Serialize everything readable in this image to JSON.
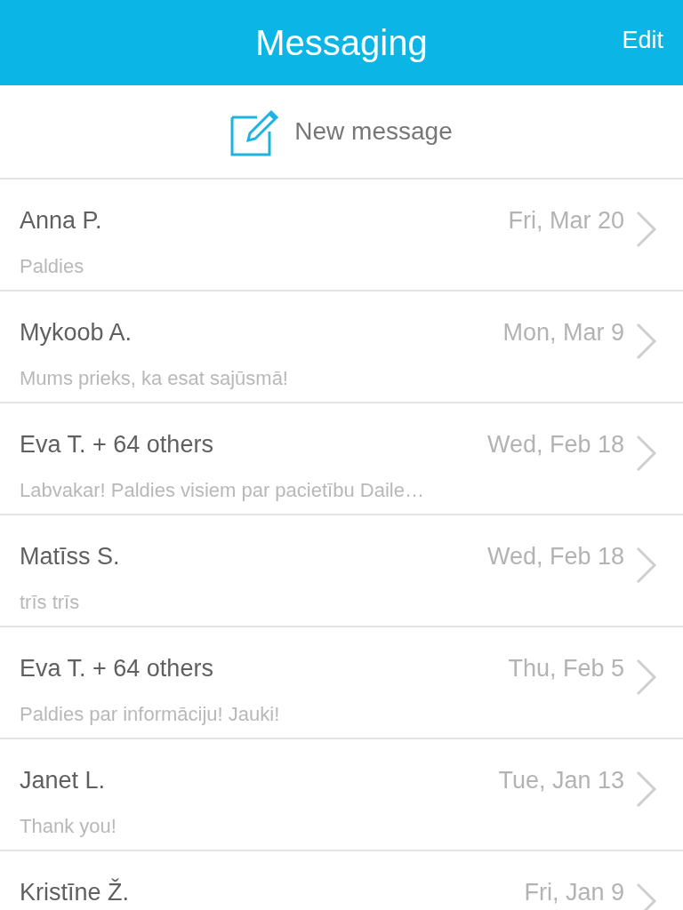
{
  "header": {
    "title": "Messaging",
    "edit": "Edit"
  },
  "new_message": {
    "label": "New message"
  },
  "conversations": [
    {
      "name": "Anna P.",
      "date": "Fri, Mar 20",
      "preview": "Paldies"
    },
    {
      "name": "Mykoob A.",
      "date": "Mon, Mar 9",
      "preview": "Mums prieks, ka esat sajūsmā!"
    },
    {
      "name": "Eva T. + 64 others",
      "date": "Wed, Feb 18",
      "preview": "Labvakar! Paldies visiem par pacietību Daile…"
    },
    {
      "name": "Matīss S.",
      "date": "Wed, Feb 18",
      "preview": "trīs trīs"
    },
    {
      "name": "Eva T. + 64 others",
      "date": "Thu, Feb 5",
      "preview": "Paldies par informāciju! Jauki!"
    },
    {
      "name": "Janet L.",
      "date": "Tue, Jan 13",
      "preview": "Thank you!"
    },
    {
      "name": "Kristīne Ž.",
      "date": "Fri, Jan 9"
    }
  ]
}
